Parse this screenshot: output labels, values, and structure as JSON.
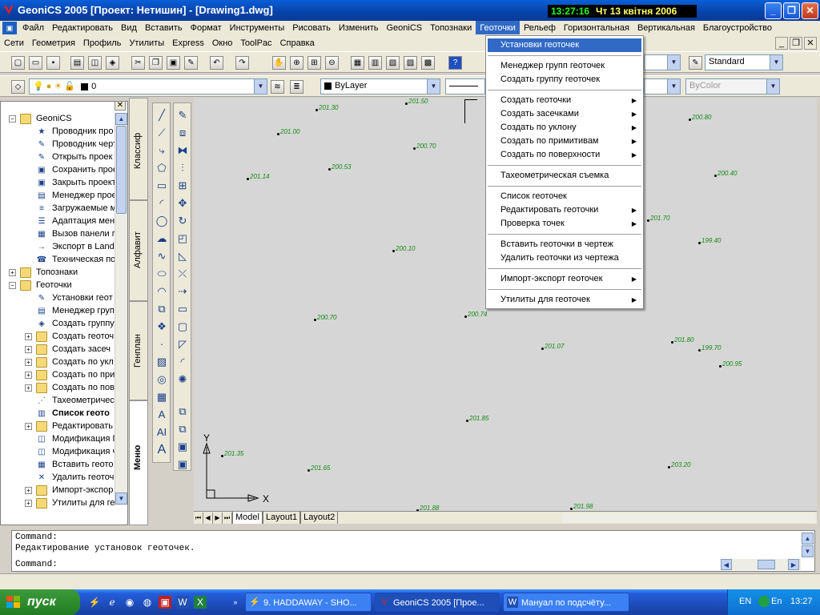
{
  "window": {
    "title": "GeoniCS 2005 [Проект: Нетишин] - [Drawing1.dwg]",
    "clock_time": "13:27:16",
    "clock_date": "Чт 13 квітня 2006",
    "minimize": "_",
    "maximize": "❐",
    "close": "✕"
  },
  "menubar1": {
    "items": [
      "Файл",
      "Редактировать",
      "Вид",
      "Вставить",
      "Формат",
      "Инструменты",
      "Рисовать",
      "Изменить",
      "GeoniCS",
      "Топознаки",
      "Геоточки",
      "Рельеф",
      "Горизонтальная",
      "Вертикальная",
      "Благоустройство"
    ],
    "active_index": 10
  },
  "menubar2": {
    "items": [
      "Сети",
      "Геометрия",
      "Профиль",
      "Утилиты",
      "Express",
      "Окно",
      "ToolPac",
      "Справка"
    ]
  },
  "toolbar1": {
    "textstyle": "Standard"
  },
  "toolbar2": {
    "layer": "0",
    "color": "ByLayer",
    "lineweight": "ByColor"
  },
  "tree": {
    "root": "GeoniCS",
    "items": [
      "Проводник про",
      "Проводник черт",
      "Открыть проек",
      "Сохранить прое",
      "Закрыть проект",
      "Менеджер прое",
      "Загружаемые м",
      "Адаптация мен",
      "Вызов панели г",
      "Экспорт в Land",
      "Техническая по",
      "Топознаки",
      "Геоточки",
      "Установки геот",
      "Менеджер груп",
      "Создать группу",
      "Создать геоточ",
      "Создать засеч",
      "Создать по укл",
      "Создать по при",
      "Создать по пов",
      "Тахеометричес",
      "Список геото",
      "Редактировать",
      "Модификация Г",
      "Модификация ч",
      "Вставить геото",
      "Удалить геоточ",
      "Импорт-экспор",
      "Утилиты для ге"
    ]
  },
  "vtabs": [
    "Классиф",
    "Алфавит",
    "Генплан",
    "Меню"
  ],
  "geomenu": {
    "items": [
      "Установки геоточек",
      "Менеджер групп геоточек",
      "Создать группу геоточек",
      "Создать геоточки",
      "Создать засечками",
      "Создать по уклону",
      "Создать по примитивам",
      "Создать по поверхности",
      "Тахеометрическая съемка",
      "Список геоточек",
      "Редактировать геоточки",
      "Проверка точек",
      "Вставить геоточки в чертеж",
      "Удалить геоточки из чертежа",
      "Импорт-экспорт геоточек",
      "Утилиты для геоточек"
    ]
  },
  "points": [
    "201.30",
    "201.50",
    "201.00",
    "200.70",
    "201.14",
    "200.53",
    "200.10",
    "200.70",
    "200.74",
    "201.07",
    "201.85",
    "201.35",
    "201.65",
    "201.88",
    "201.98",
    "200.80",
    "200.40",
    "201.70",
    "199.40",
    "201.80",
    "199.70",
    "200.95",
    "203.20"
  ],
  "ucs": {
    "x": "X",
    "y": "Y"
  },
  "layout_tabs": [
    "Model",
    "Layout1",
    "Layout2"
  ],
  "command": {
    "line1": "Command:",
    "line2": "Редактирование установок геоточек.",
    "prompt": "Command:"
  },
  "taskbar": {
    "start": "пуск",
    "tasks": [
      "9. HADDAWAY - SHO...",
      "GeoniCS 2005 [Прое...",
      "Мануал по подсчёту..."
    ],
    "lang1": "EN",
    "lang2": "En",
    "time": "13:27"
  },
  "colors": {
    "menu_highlight": "#316ac5",
    "point_label": "#138a13",
    "canvas": "#d6d6d6"
  }
}
